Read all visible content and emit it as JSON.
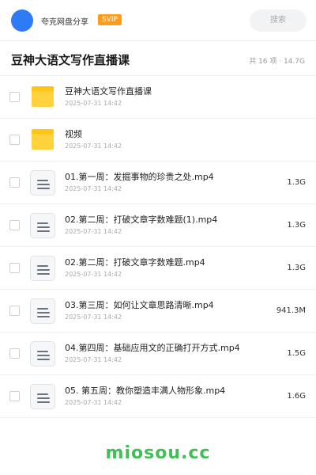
{
  "header": {
    "share_name": "夸克网盘分享",
    "badge": "SVIP",
    "search_placeholder": "搜索"
  },
  "folder": {
    "title": "豆神大语文写作直播课",
    "summary": "共 16 项 · 14.7G"
  },
  "files": [
    {
      "type": "folder",
      "name": "豆神大语文写作直播课",
      "date": "2025-07-31 14:42",
      "size": ""
    },
    {
      "type": "folder",
      "name": "视频",
      "date": "2025-07-31 14:42",
      "size": ""
    },
    {
      "type": "video",
      "name": "01.第一周：发掘事物的珍贵之处.mp4",
      "date": "2025-07-31 14:42",
      "size": "1.3G"
    },
    {
      "type": "video",
      "name": "02.第二周：打破文章字数难题(1).mp4",
      "date": "2025-07-31 14:42",
      "size": "1.3G"
    },
    {
      "type": "video",
      "name": "02.第二周：打破文章字数难题.mp4",
      "date": "2025-07-31 14:42",
      "size": "1.3G"
    },
    {
      "type": "video",
      "name": "03.第三周：如何让文章思路清晰.mp4",
      "date": "2025-07-31 14:42",
      "size": "941.3M"
    },
    {
      "type": "video",
      "name": "04.第四周：基础应用文的正确打开方式.mp4",
      "date": "2025-07-31 14:42",
      "size": "1.5G"
    },
    {
      "type": "video",
      "name": "05. 第五周：教你塑造丰满人物形象.mp4",
      "date": "2025-07-31 14:42",
      "size": "1.6G"
    }
  ],
  "watermark": "miosou.cc",
  "colors": {
    "accent": "#2f7bf6",
    "svip": "#ff9c1a",
    "folder": "#ffc414",
    "watermark": "#3fbf54"
  }
}
